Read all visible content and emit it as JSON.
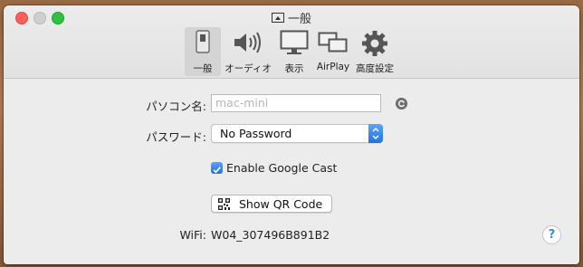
{
  "window": {
    "title": "一般"
  },
  "toolbar": {
    "items": [
      {
        "label": "一般",
        "icon": "switch-icon",
        "selected": true
      },
      {
        "label": "オーディオ",
        "icon": "speaker-icon",
        "selected": false
      },
      {
        "label": "表示",
        "icon": "display-icon",
        "selected": false
      },
      {
        "label": "AirPlay",
        "icon": "airplay-screens-icon",
        "selected": false
      },
      {
        "label": "高度設定",
        "icon": "gear-icon",
        "selected": false
      }
    ]
  },
  "form": {
    "computer_name_label": "パソコン名:",
    "computer_name_placeholder": "mac-mini",
    "password_label": "パスワード:",
    "password_value": "No Password",
    "google_cast_label": "Enable Google Cast",
    "google_cast_checked": true,
    "qr_button_label": "Show QR Code",
    "wifi_label": "WiFi:",
    "wifi_value": "W04_307496B891B2"
  },
  "colors": {
    "accent": "#1c72ea",
    "close": "#fc5f57",
    "maximize": "#2cc43f"
  }
}
